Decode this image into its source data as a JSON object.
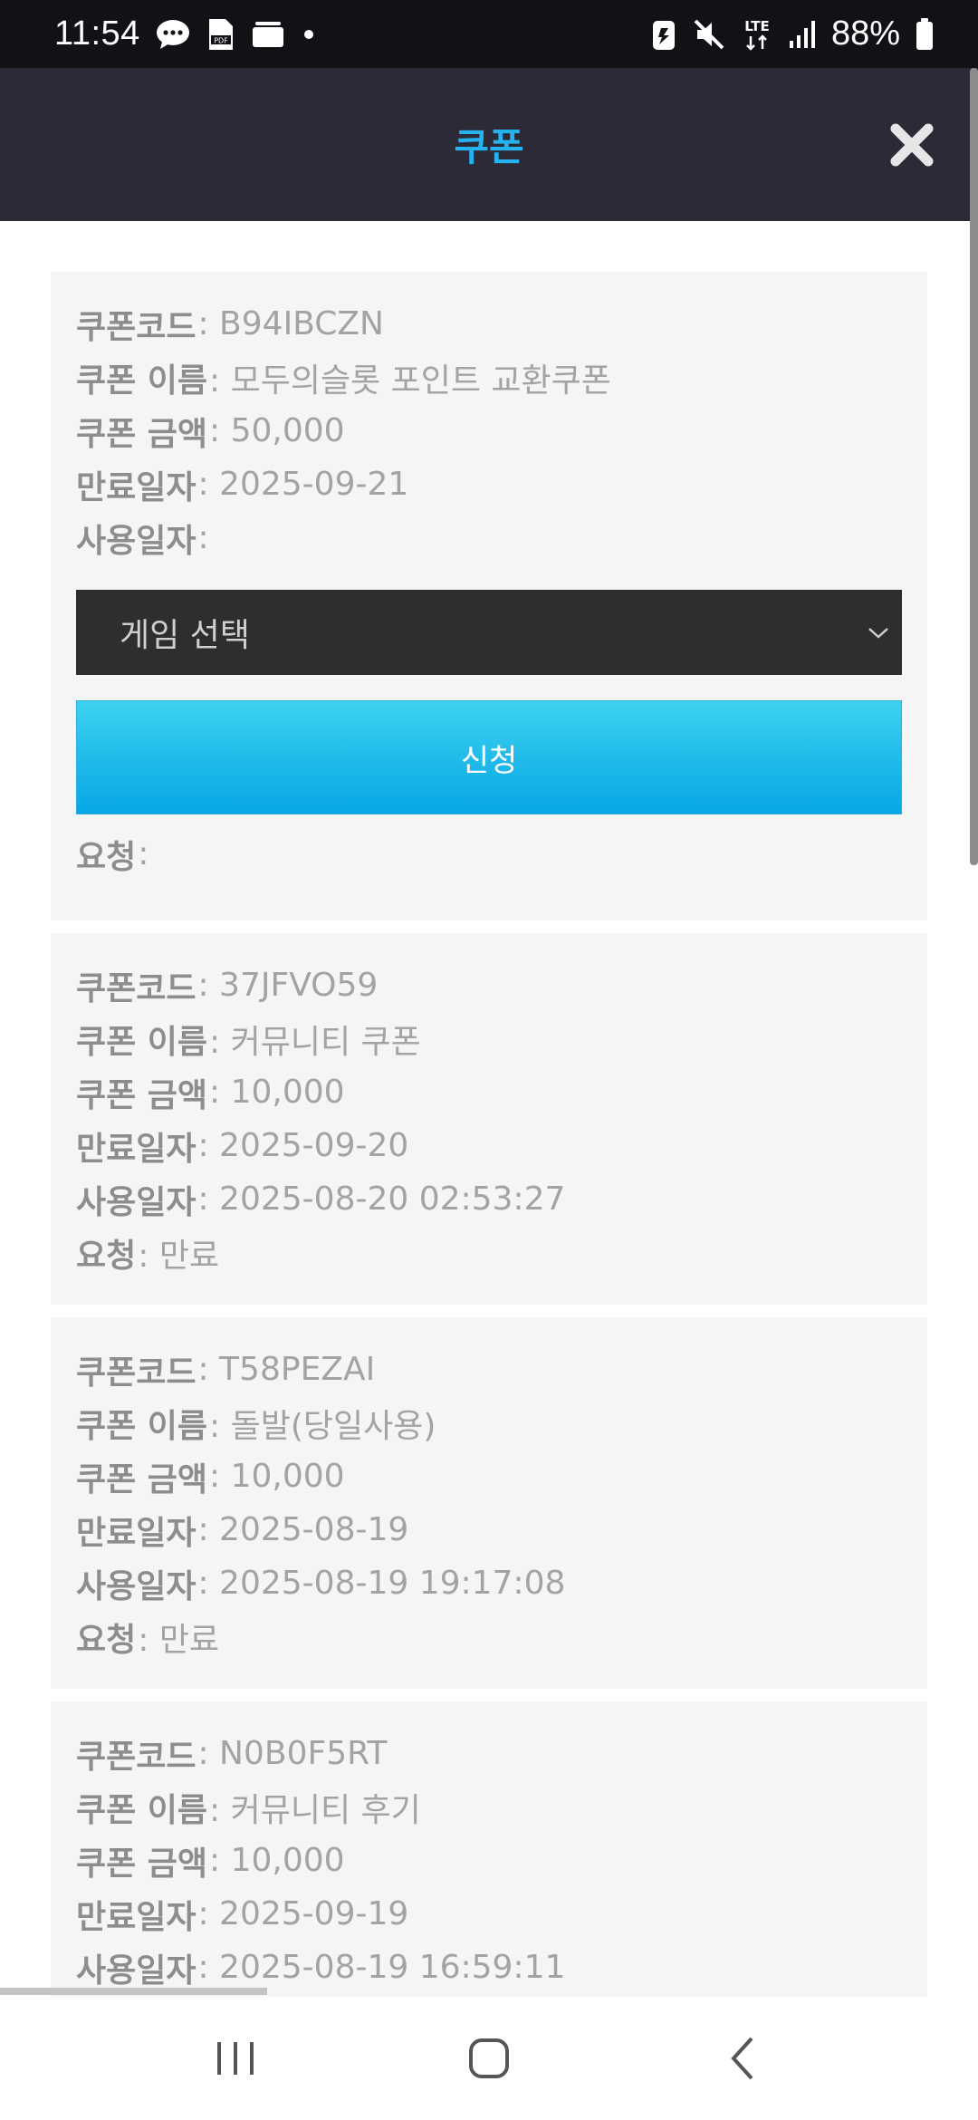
{
  "status_bar": {
    "time": "11:54",
    "battery": "88%",
    "icons": [
      "chat-icon",
      "pdf-icon",
      "folder-icon",
      "dot-icon",
      "battery-saver-icon",
      "mute-icon",
      "lte-icon",
      "signal-icon",
      "battery-icon"
    ]
  },
  "header": {
    "title": "쿠폰",
    "close_icon": "close-icon",
    "title_color": "#25b2f0",
    "bg_color": "#2b2a36"
  },
  "coupons": [
    {
      "code_label": "쿠폰코드",
      "code": ": B94IBCZN",
      "name_label": "쿠폰 이름",
      "name": ": 모두의슬롯 포인트 교환쿠폰",
      "amount_label": "쿠폰 금액",
      "amount": ": 50,000",
      "expiry_label": "만료일자",
      "expiry": ": 2025-09-21",
      "used_label": "사용일자",
      "used": ":",
      "select_placeholder": "게임 선택",
      "apply_label": "신청",
      "request_label": "요청",
      "request": ":"
    },
    {
      "code_label": "쿠폰코드",
      "code": ": 37JFVO59",
      "name_label": "쿠폰 이름",
      "name": ": 커뮤니티 쿠폰",
      "amount_label": "쿠폰 금액",
      "amount": ": 10,000",
      "expiry_label": "만료일자",
      "expiry": ": 2025-09-20",
      "used_label": "사용일자",
      "used": ": 2025-08-20 02:53:27",
      "request_label": "요청",
      "request": ": 만료"
    },
    {
      "code_label": "쿠폰코드",
      "code": ": T58PEZAI",
      "name_label": "쿠폰 이름",
      "name": ": 돌발(당일사용)",
      "amount_label": "쿠폰 금액",
      "amount": ": 10,000",
      "expiry_label": "만료일자",
      "expiry": ": 2025-08-19",
      "used_label": "사용일자",
      "used": ": 2025-08-19 19:17:08",
      "request_label": "요청",
      "request": ": 만료"
    },
    {
      "code_label": "쿠폰코드",
      "code": ": N0B0F5RT",
      "name_label": "쿠폰 이름",
      "name": ": 커뮤니티 후기",
      "amount_label": "쿠폰 금액",
      "amount": ": 10,000",
      "expiry_label": "만료일자",
      "expiry": ": 2025-09-19",
      "used_label": "사용일자",
      "used": ": 2025-08-19 16:59:11"
    }
  ],
  "nav": {
    "recents_icon": "recents-icon",
    "home_icon": "home-icon",
    "back_icon": "back-icon"
  }
}
